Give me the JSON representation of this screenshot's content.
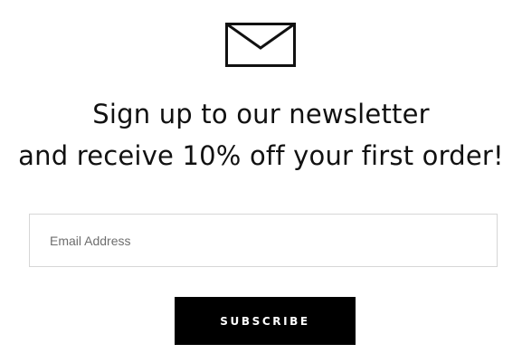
{
  "icon": "envelope-icon",
  "headline": {
    "line1": "Sign up to our newsletter",
    "line2": "and receive 10% off your first order!"
  },
  "email": {
    "placeholder": "Email Address",
    "value": ""
  },
  "subscribe_label": "SUBSCRIBE",
  "colors": {
    "text": "#111111",
    "button_bg": "#000000",
    "button_text": "#ffffff",
    "input_border": "#d6d6d6",
    "placeholder": "#6e6e6e"
  }
}
